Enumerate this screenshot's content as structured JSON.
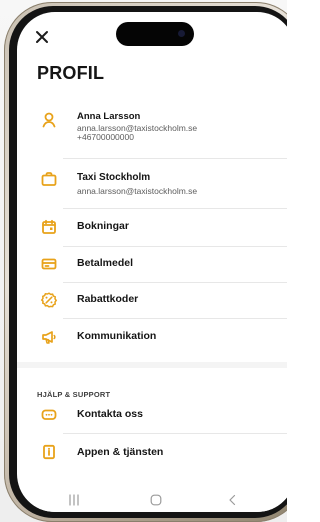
{
  "screen": {
    "title": "PROFIL"
  },
  "profile": {
    "name": "Anna Larsson",
    "email": "anna.larsson@taxistockholm.se",
    "phone": "+46700000000"
  },
  "company": {
    "name": "Taxi Stockholm",
    "email": "anna.larsson@taxistockholm.se"
  },
  "menu": {
    "bookings": "Bokningar",
    "payment_methods": "Betalmedel",
    "discount_codes": "Rabattkoder",
    "communication": "Kommunikation"
  },
  "help_section": {
    "title": "HJÄLP & SUPPORT",
    "contact": "Kontakta oss",
    "app_service": "Appen & tjänsten"
  },
  "colors": {
    "accent": "#e8a21a",
    "text": "#151515",
    "muted": "#5d5d5d",
    "divider": "#e7e7e7",
    "background": "#ffffff"
  },
  "icons": {
    "close": "close-icon",
    "user": "user-icon",
    "briefcase": "briefcase-icon",
    "calendar": "calendar-icon",
    "card": "credit-card-icon",
    "discount": "discount-icon",
    "megaphone": "megaphone-icon",
    "chat": "chat-icon",
    "info": "info-icon",
    "recent_apps": "recent-apps-icon",
    "home": "home-icon",
    "back": "back-icon"
  }
}
